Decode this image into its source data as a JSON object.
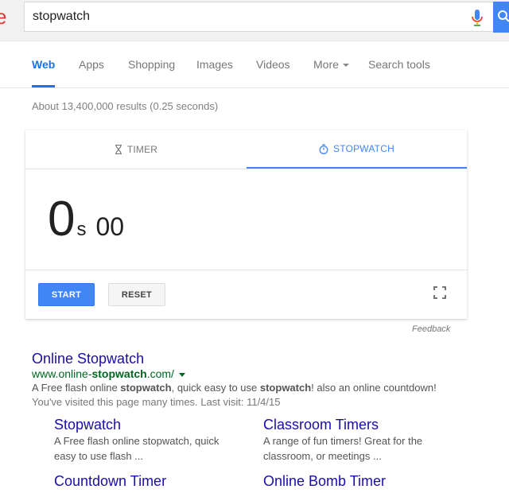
{
  "header": {
    "logo_fragment": "e",
    "search_value": "stopwatch",
    "icons": [
      "microphone-icon",
      "search-icon"
    ]
  },
  "tabs": [
    {
      "label": "Web",
      "active": true
    },
    {
      "label": "Apps"
    },
    {
      "label": "Shopping"
    },
    {
      "label": "Images"
    },
    {
      "label": "Videos"
    },
    {
      "label": "More"
    },
    {
      "label": "Search tools"
    }
  ],
  "result_stats": "About 13,400,000 results (0.25 seconds)",
  "stopwatch": {
    "tab_timer": "TIMER",
    "tab_stopwatch": "STOPWATCH",
    "seconds": "0",
    "seconds_unit": "s",
    "centiseconds": "00",
    "start_label": "START",
    "reset_label": "RESET",
    "feedback": "Feedback",
    "accent_color": "#4285f4"
  },
  "result": {
    "title": "Online Stopwatch",
    "url_prefix": "www.online-",
    "url_bold": "stopwatch",
    "url_suffix": ".com/",
    "snippet_1": "A Free flash online ",
    "snippet_bold_1": "stopwatch",
    "snippet_2": ", quick easy to use ",
    "snippet_bold_2": "stopwatch",
    "snippet_3": "! also an online countdown!",
    "visited": "You've visited this page many times. Last visit: 11/4/15",
    "sitelinks": [
      {
        "title": "Stopwatch",
        "desc": "A Free flash online stopwatch, quick easy to use flash ..."
      },
      {
        "title": "Classroom Timers",
        "desc": "A range of fun timers! Great for the classroom, or meetings ..."
      },
      {
        "title": "Countdown Timer",
        "desc": ""
      },
      {
        "title": "Online Bomb Timer",
        "desc": ""
      }
    ]
  }
}
